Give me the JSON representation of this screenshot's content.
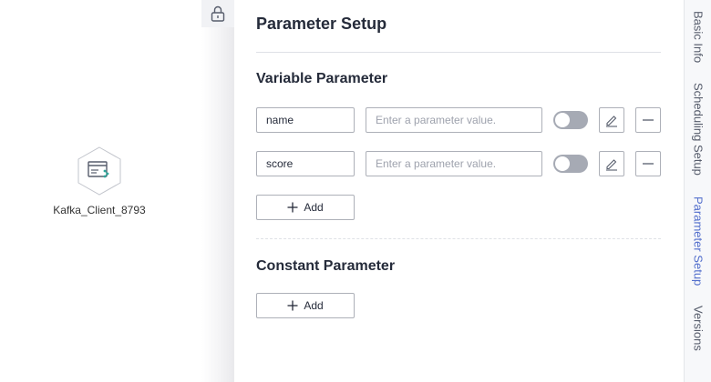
{
  "canvas": {
    "node_label": "Kafka_Client_8793"
  },
  "panel": {
    "title": "Parameter Setup",
    "variable_section": {
      "title": "Variable Parameter",
      "rows": [
        {
          "name": "name",
          "value": "",
          "placeholder": "Enter a parameter value."
        },
        {
          "name": "score",
          "value": "",
          "placeholder": "Enter a parameter value."
        }
      ],
      "add_label": "Add"
    },
    "constant_section": {
      "title": "Constant Parameter",
      "add_label": "Add"
    }
  },
  "side_tabs": [
    {
      "label": "Basic Info",
      "active": false
    },
    {
      "label": "Scheduling Setup",
      "active": false
    },
    {
      "label": "Parameter Setup",
      "active": true
    },
    {
      "label": "Versions",
      "active": false
    }
  ],
  "colors": {
    "accent": "#526ecc",
    "toggle_off": "#a6aab4",
    "text": "#252b3a",
    "node_teal": "#2fa69a"
  },
  "icons": [
    "lock-icon",
    "kafka-node-icon",
    "edit-icon",
    "minus-icon",
    "plus-icon"
  ]
}
